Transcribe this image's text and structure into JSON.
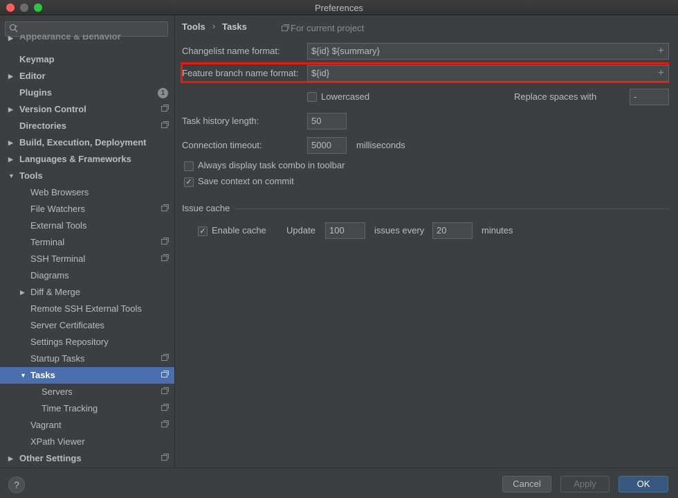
{
  "window": {
    "title": "Preferences"
  },
  "sidebar": {
    "search": {
      "placeholder": ""
    },
    "items": [
      {
        "label": "Appearance & Behavior"
      },
      {
        "label": "Keymap"
      },
      {
        "label": "Editor"
      },
      {
        "label": "Plugins",
        "badge": "1"
      },
      {
        "label": "Version Control"
      },
      {
        "label": "Directories"
      },
      {
        "label": "Build, Execution, Deployment"
      },
      {
        "label": "Languages & Frameworks"
      },
      {
        "label": "Tools"
      },
      {
        "label": "Web Browsers"
      },
      {
        "label": "File Watchers"
      },
      {
        "label": "External Tools"
      },
      {
        "label": "Terminal"
      },
      {
        "label": "SSH Terminal"
      },
      {
        "label": "Diagrams"
      },
      {
        "label": "Diff & Merge"
      },
      {
        "label": "Remote SSH External Tools"
      },
      {
        "label": "Server Certificates"
      },
      {
        "label": "Settings Repository"
      },
      {
        "label": "Startup Tasks"
      },
      {
        "label": "Tasks"
      },
      {
        "label": "Servers"
      },
      {
        "label": "Time Tracking"
      },
      {
        "label": "Vagrant"
      },
      {
        "label": "XPath Viewer"
      },
      {
        "label": "Other Settings"
      }
    ]
  },
  "breadcrumb": {
    "parent": "Tools",
    "separator": "›",
    "current": "Tasks",
    "scope": "For current project"
  },
  "form": {
    "changelist_label": "Changelist name format:",
    "changelist_value": "${id} ${summary}",
    "feature_branch_label": "Feature branch name format:",
    "feature_branch_value": "${id}",
    "lowercased_label": "Lowercased",
    "replace_spaces_label": "Replace spaces with",
    "replace_spaces_value": "-",
    "history_label": "Task history length:",
    "history_value": "50",
    "timeout_label": "Connection timeout:",
    "timeout_value": "5000",
    "timeout_unit": "milliseconds",
    "always_display_label": "Always display task combo in toolbar",
    "save_context_label": "Save context on commit"
  },
  "issue_cache": {
    "title": "Issue cache",
    "enable_label": "Enable cache",
    "update_label": "Update",
    "update_value": "100",
    "issues_every_label": "issues every",
    "every_value": "20",
    "minutes_label": "minutes"
  },
  "buttons": {
    "help": "?",
    "cancel": "Cancel",
    "apply": "Apply",
    "ok": "OK"
  },
  "colors": {
    "background": "#3c3f41",
    "selection": "#4b6eaf",
    "highlight_box": "#e8190a",
    "ok_button": "#365880"
  }
}
